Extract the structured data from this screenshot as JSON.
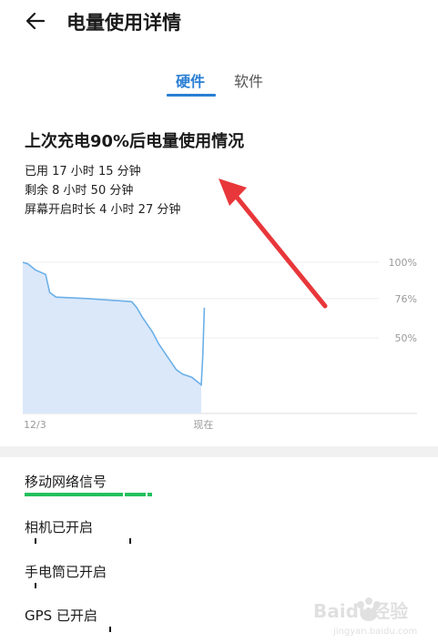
{
  "header": {
    "title": "电量使用详情",
    "back_icon": "arrow-left-icon"
  },
  "tabs": [
    {
      "label": "硬件",
      "active": true
    },
    {
      "label": "软件",
      "active": false
    }
  ],
  "usage": {
    "title": "上次充电90%后电量使用情况",
    "used": "已用 17 小时 15 分钟",
    "remaining": "剩余 8 小时 50 分钟",
    "screen_on": "屏幕开启时长 4 小时 27 分钟"
  },
  "chart_data": {
    "type": "area",
    "y_ticks": [
      "100%",
      "76%",
      "50%"
    ],
    "x_ticks": [
      "12/3",
      "现在"
    ],
    "ylim": [
      0,
      100
    ],
    "series": [
      {
        "values": [
          {
            "x": 0,
            "y": 100
          },
          {
            "x": 0.5,
            "y": 99
          },
          {
            "x": 1.2,
            "y": 95
          },
          {
            "x": 2.2,
            "y": 92
          },
          {
            "x": 2.6,
            "y": 80
          },
          {
            "x": 3.2,
            "y": 77
          },
          {
            "x": 6.2,
            "y": 76
          },
          {
            "x": 10.5,
            "y": 74
          },
          {
            "x": 11.0,
            "y": 70
          },
          {
            "x": 11.5,
            "y": 64
          },
          {
            "x": 12.5,
            "y": 54
          },
          {
            "x": 13.1,
            "y": 46
          },
          {
            "x": 14.0,
            "y": 37
          },
          {
            "x": 14.8,
            "y": 29
          },
          {
            "x": 15.4,
            "y": 26
          },
          {
            "x": 16.3,
            "y": 24
          },
          {
            "x": 17.2,
            "y": 19
          },
          {
            "x": 17.35,
            "y": 38
          },
          {
            "x": 17.5,
            "y": 70
          }
        ]
      }
    ],
    "fill_color": "#dbe8fa",
    "line_color": "#6cb0e8"
  },
  "rows": [
    {
      "label": "移动网络信号",
      "bar_color": "#23c05e"
    },
    {
      "label": "相机已开启"
    },
    {
      "label": "手电筒已开启"
    },
    {
      "label": "GPS 已开启"
    }
  ],
  "watermark": {
    "brand": "Baidu经验",
    "domain": "jingyan.baidu.com"
  },
  "annotation": {
    "arrow_color": "#e8373a"
  }
}
